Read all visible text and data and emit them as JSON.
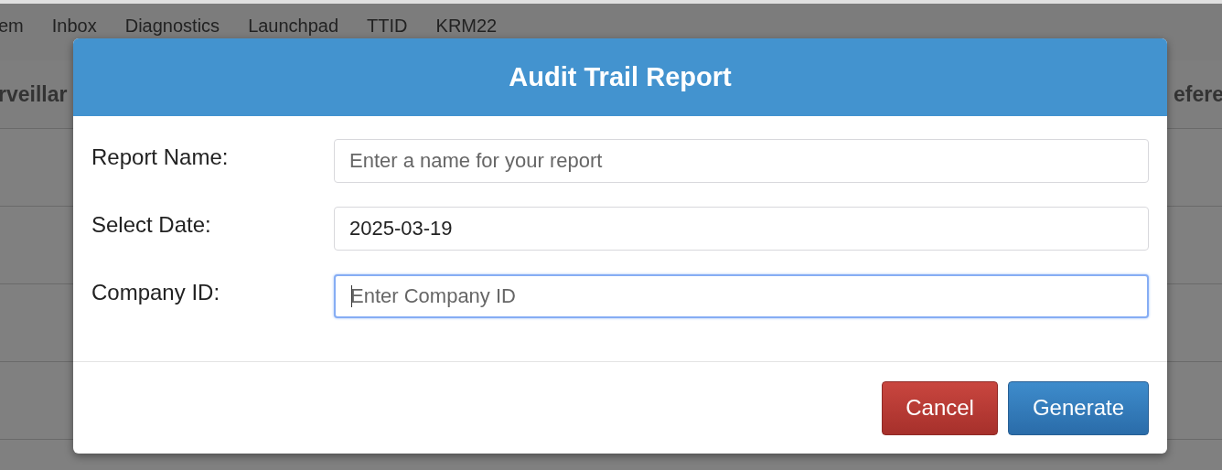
{
  "nav": {
    "items": [
      "em",
      "Inbox",
      "Diagnostics",
      "Launchpad",
      "TTID",
      "KRM22"
    ]
  },
  "table": {
    "columns": [
      "rveillar",
      "efere"
    ]
  },
  "dialog": {
    "title": "Audit Trail Report",
    "fields": [
      {
        "label": "Report Name:",
        "placeholder": "Enter a name for your report",
        "focused": false
      },
      {
        "label": "Select Date:",
        "value": "2025-03-19",
        "focused": false
      },
      {
        "label": "Company ID:",
        "placeholder": "Enter Company ID",
        "focused": true
      }
    ],
    "buttons": [
      {
        "label": "Cancel",
        "kind": "danger"
      },
      {
        "label": "Generate",
        "kind": "primary"
      }
    ]
  }
}
